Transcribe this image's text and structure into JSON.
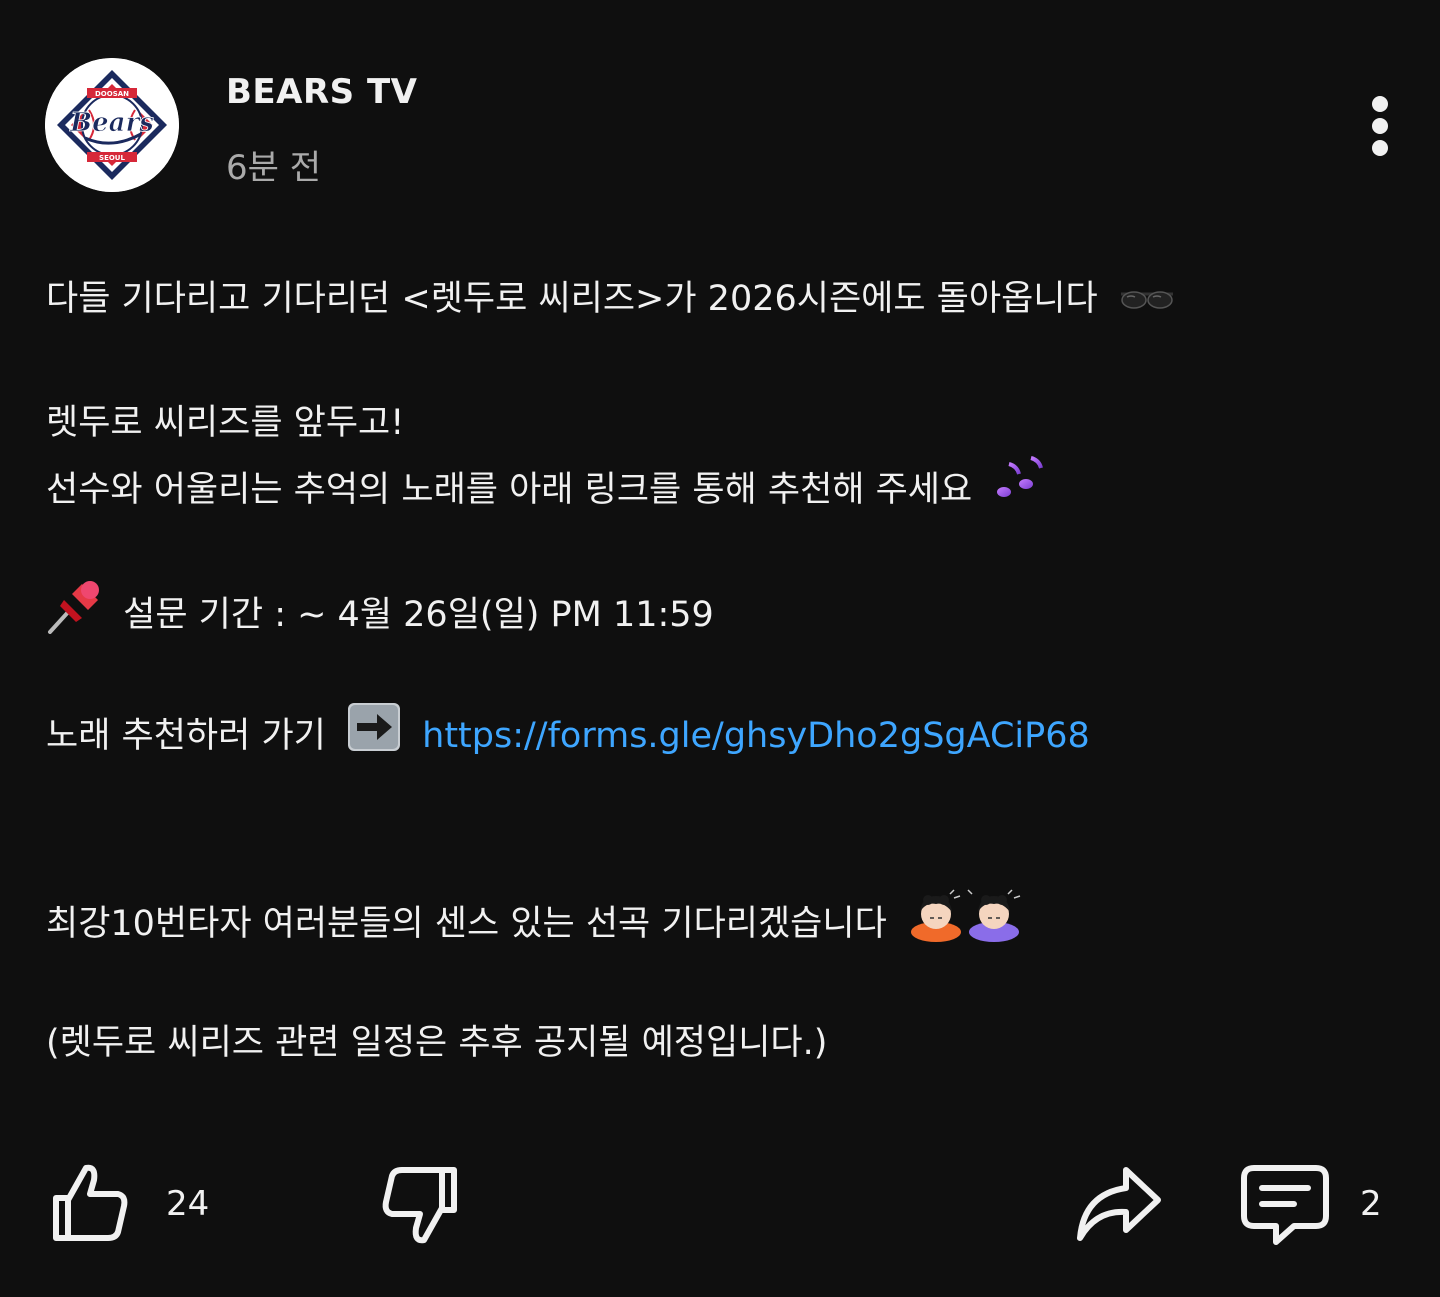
{
  "channel": {
    "name": "BEARS TV",
    "time_ago": "6분 전",
    "avatar_brand_top": "DOOSAN",
    "avatar_brand_script": "Bears",
    "avatar_brand_bottom": "SEOUL",
    "avatar_colors": [
      "#1b2a5e",
      "#d62839",
      "#ffffff"
    ]
  },
  "post": {
    "line1": "다들 기다리고 기다리던 <렛두로 씨리즈>가 2026시즌에도 돌아옵니다",
    "line1_emoji": "🕶",
    "line2": "렛두로 씨리즈를 앞두고!",
    "line3": "선수와 어울리는 추억의 노래를 아래 링크를 통해 추천해 주세요",
    "line3_emoji": "🎶",
    "survey_emoji": "📌",
    "survey_period": "설문 기간 : ~ 4월 26일(일) PM 11:59",
    "recommend_label": "노래 추천하러 가기",
    "recommend_emoji": "➡️",
    "link_url": "https://forms.gle/ghsyDho2gSgACiP68",
    "closing_line": "최강10번타자 여러분들의 센스 있는 선곡 기다리겠습니다",
    "closing_emoji": "🙇‍♀️🙇‍♀️",
    "note": "(렛두로 씨리즈 관련 일정은 추후 공지될 예정입니다.)"
  },
  "actions": {
    "like_count": "24",
    "comment_count": "2",
    "icons": [
      "thumbs-up-icon",
      "thumbs-down-icon",
      "share-icon",
      "comment-icon",
      "more-vertical-icon"
    ]
  },
  "colors": {
    "background": "#0f0f0f",
    "text": "#f1f1f1",
    "secondary_text": "#aaaaaa",
    "link": "#3ea6ff"
  }
}
